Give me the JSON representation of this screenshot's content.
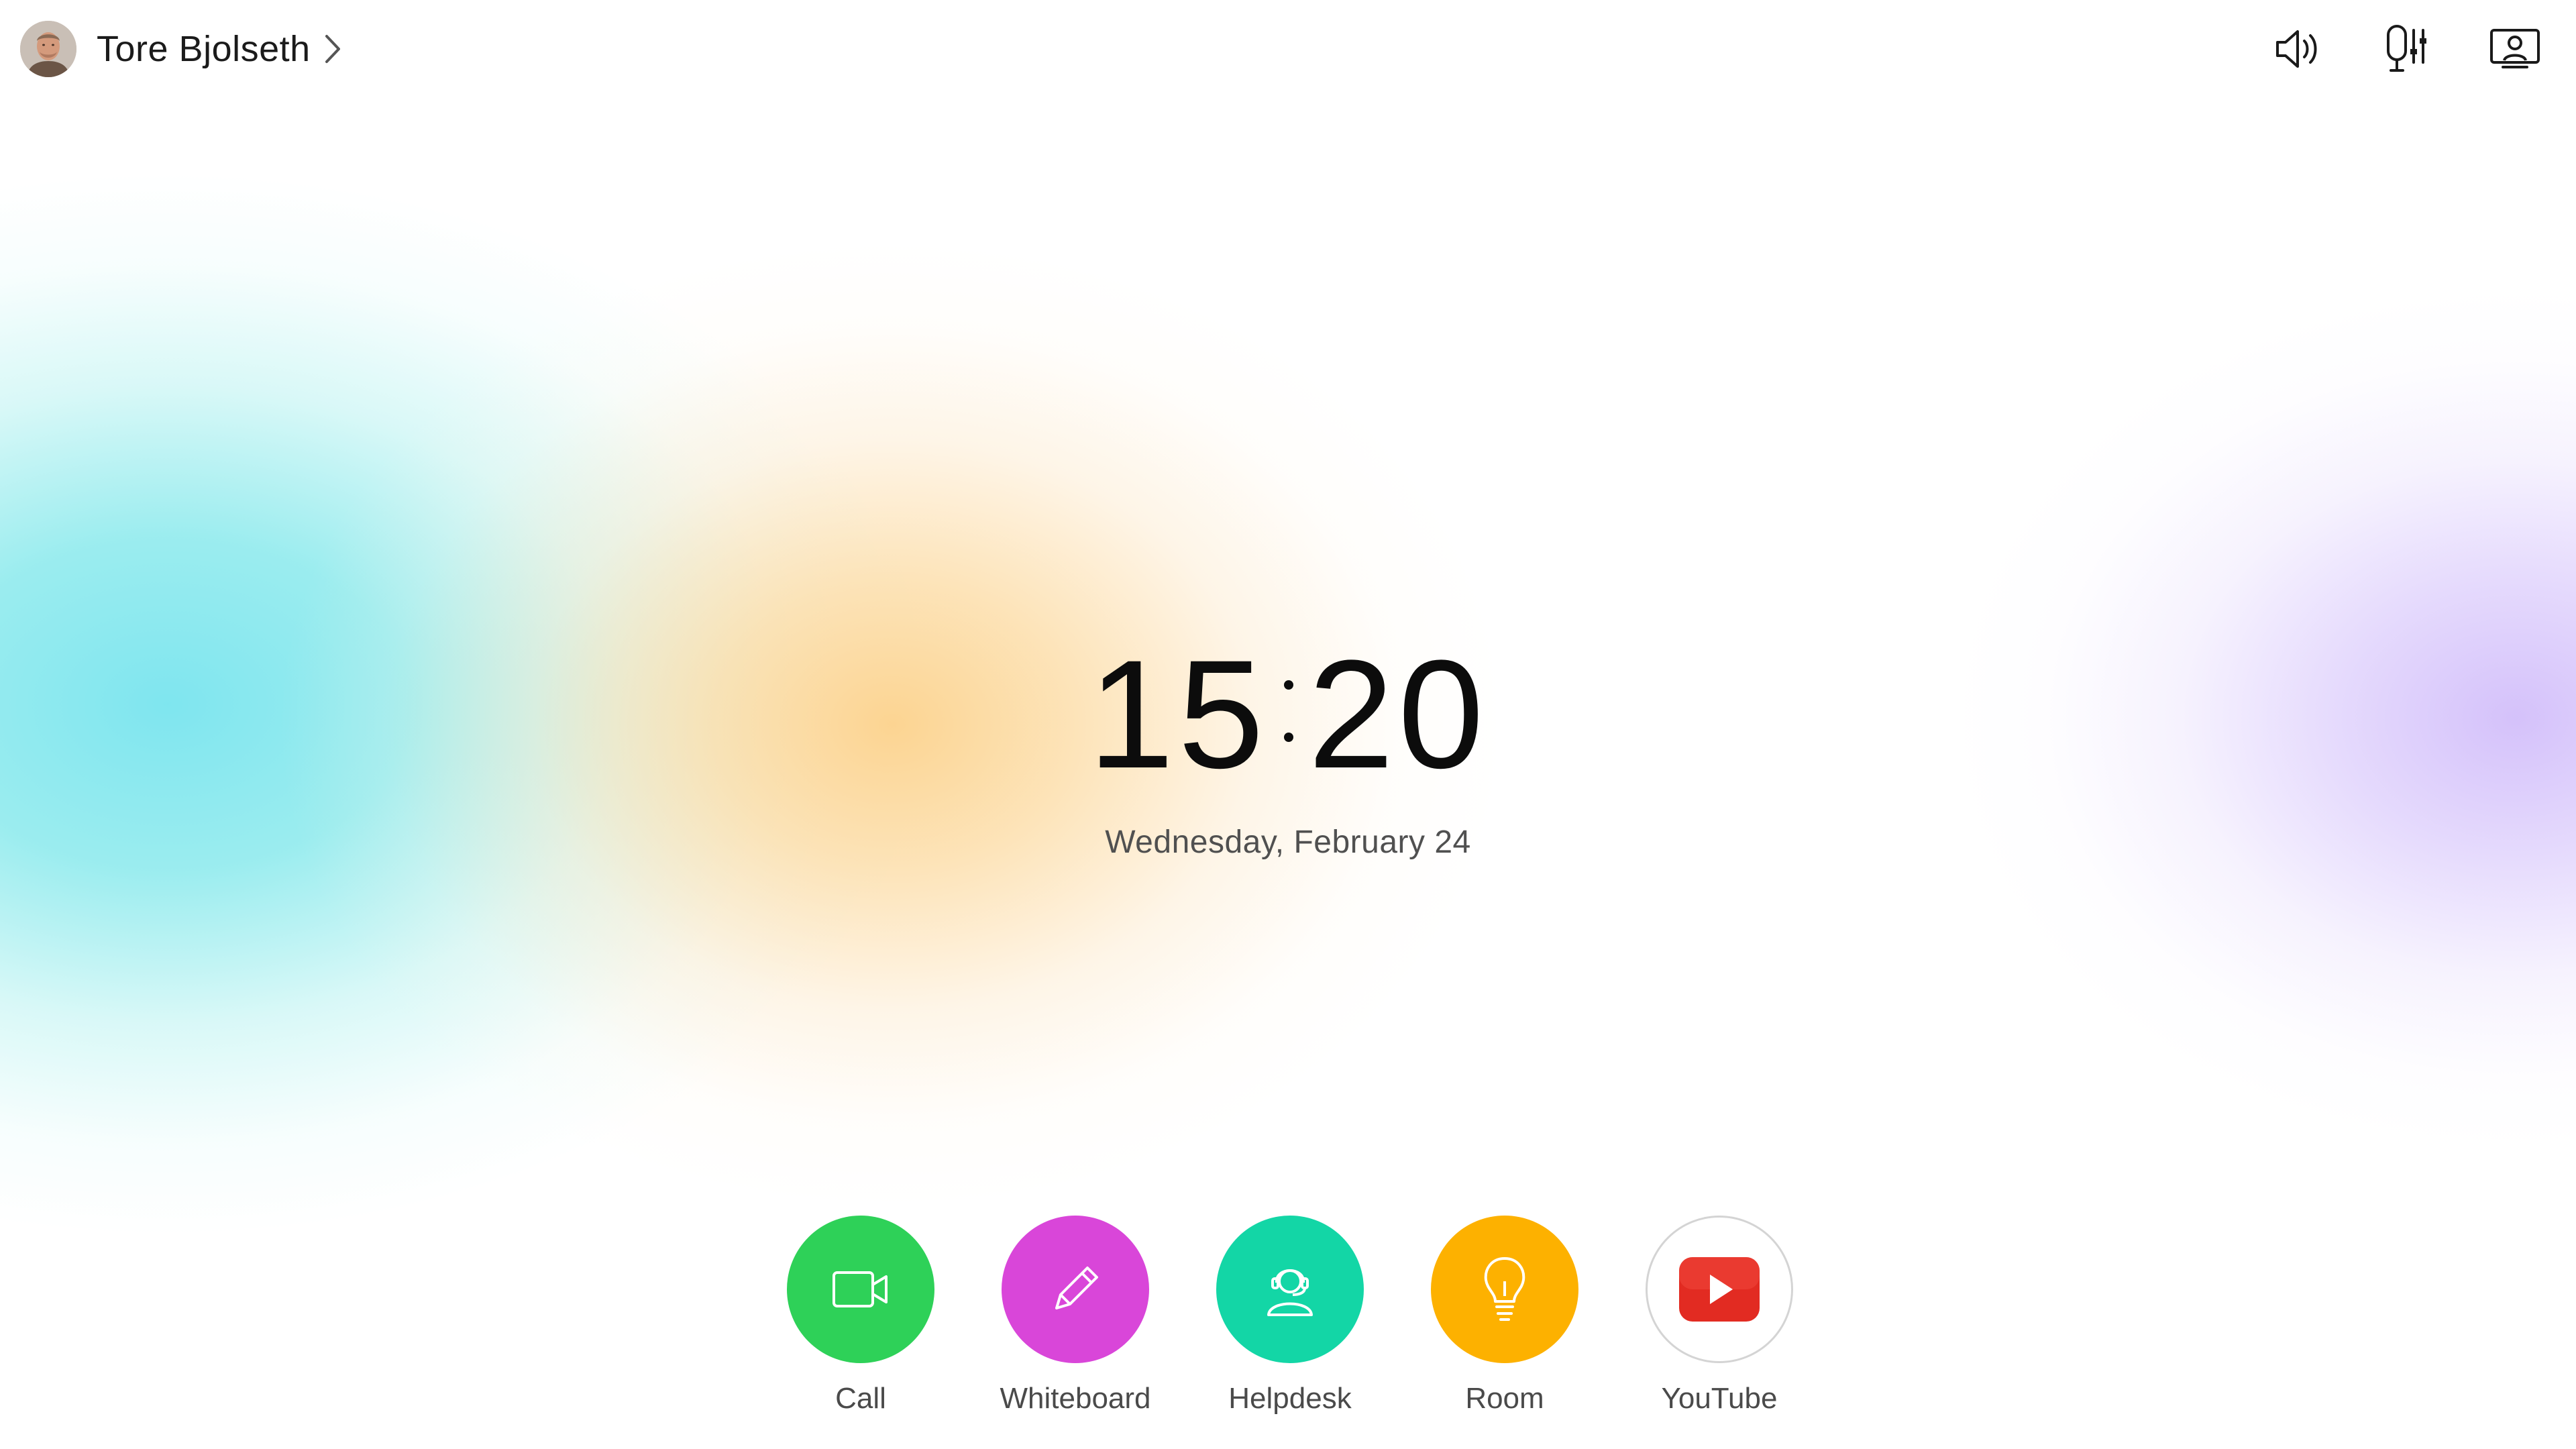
{
  "user": {
    "name": "Tore Bjolseth"
  },
  "top_icons": [
    {
      "name": "volume-icon"
    },
    {
      "name": "microphone-settings-icon"
    },
    {
      "name": "self-view-icon"
    }
  ],
  "clock": {
    "hours": "15",
    "minutes": "20",
    "date": "Wednesday, February 24"
  },
  "apps": [
    {
      "label": "Call",
      "color": "#2ed158",
      "icon": "video-camera-icon"
    },
    {
      "label": "Whiteboard",
      "color": "#d946d9",
      "icon": "pencil-icon"
    },
    {
      "label": "Helpdesk",
      "color": "#13d6a6",
      "icon": "headset-person-icon"
    },
    {
      "label": "Room",
      "color": "#fdb100",
      "icon": "lightbulb-icon"
    },
    {
      "label": "YouTube",
      "color": "#ffffff",
      "icon": "youtube-play-icon"
    }
  ],
  "colors": {
    "blob_cyan": "#86e6ee",
    "blob_orange": "#fbd59a",
    "blob_purple": "#d9c8fb"
  }
}
